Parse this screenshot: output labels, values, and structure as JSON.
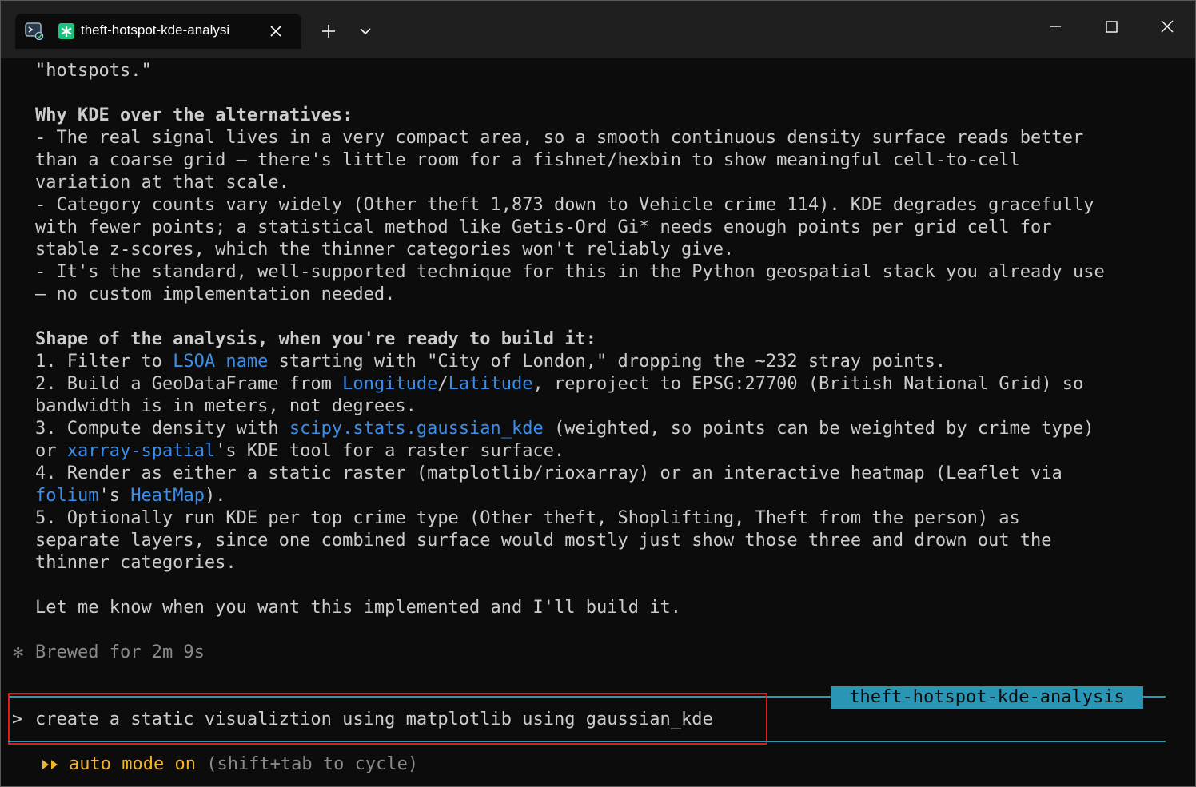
{
  "window": {
    "tab_title": "theft-hotspot-kde-analysi",
    "new_tab_symbol": "+",
    "controls": {
      "minimize": "minimize-icon",
      "maximize": "maximize-icon",
      "close": "close-icon"
    }
  },
  "colors": {
    "link": "#3b8eea",
    "accent": "#2896b4",
    "mode": "#f0b429",
    "highlight_box": "#e01b1b"
  },
  "output": {
    "l1": "\"hotspots.\"",
    "h_why": "Why KDE over the alternatives:",
    "w1a": "- The real signal lives in a very compact area, so a smooth continuous density surface reads better",
    "w1b": "than a coarse grid — there's little room for a fishnet/hexbin to show meaningful cell-to-cell",
    "w1c": "variation at that scale.",
    "w2a": "- Category counts vary widely (Other theft 1,873 down to Vehicle crime 114). KDE degrades gracefully",
    "w2b": "with fewer points; a statistical method like Getis-Ord Gi* needs enough points per grid cell for",
    "w2c": "stable z-scores, which the thinner categories won't reliably give.",
    "w3a": "- It's the standard, well-supported technique for this in the Python geospatial stack you already use",
    "w3b": "— no custom implementation needed.",
    "h_shape": "Shape of the analysis, when you're ready to build it:",
    "s1_pre": "1. Filter to ",
    "s1_code": "LSOA name",
    "s1_post": " starting with \"City of London,\" dropping the ~232 stray points.",
    "s2_pre": "2. Build a GeoDataFrame from ",
    "s2_code1": "Longitude",
    "s2_sep": "/",
    "s2_code2": "Latitude",
    "s2_post": ", reproject to EPSG:27700 (British National Grid) so",
    "s2b": "bandwidth is in meters, not degrees.",
    "s3_pre": "3. Compute density with ",
    "s3_code": "scipy.stats.gaussian_kde",
    "s3_post": " (weighted, so points can be weighted by crime type)",
    "s3b_pre": "or ",
    "s3b_code": "xarray-spatial",
    "s3b_post": "'s KDE tool for a raster surface.",
    "s4a": "4. Render as either a static raster (matplotlib/rioxarray) or an interactive heatmap (Leaflet via",
    "s4b_code1": "folium",
    "s4b_mid": "'s ",
    "s4b_code2": "HeatMap",
    "s4b_post": ").",
    "s5a": "5. Optionally run KDE per top crime type (Other theft, Shoplifting, Theft from the person) as",
    "s5b": "separate layers, since one combined surface would mostly just show those three and drown out the",
    "s5c": "thinner categories.",
    "closing": "Let me know when you want this implemented and I'll build it.",
    "brew_glyph": "✻",
    "brew": "Brewed for 2m 9s"
  },
  "prompt": {
    "project": "theft-hotspot-kde-analysis",
    "caret": ">",
    "input": "create a static visualiztion using matplotlib using gaussian_kde"
  },
  "status": {
    "mode_label": "auto mode on",
    "hint": " (shift+tab to cycle)"
  }
}
